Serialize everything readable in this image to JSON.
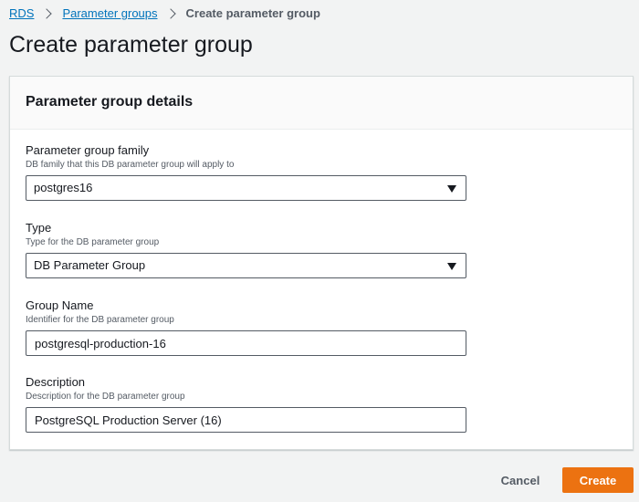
{
  "breadcrumb": {
    "items": [
      {
        "label": "RDS"
      },
      {
        "label": "Parameter groups"
      }
    ],
    "current": "Create parameter group"
  },
  "page": {
    "title": "Create parameter group"
  },
  "panel": {
    "title": "Parameter group details",
    "fields": {
      "family": {
        "label": "Parameter group family",
        "description": "DB family that this DB parameter group will apply to",
        "value": "postgres16"
      },
      "type": {
        "label": "Type",
        "description": "Type for the DB parameter group",
        "value": "DB Parameter Group"
      },
      "name": {
        "label": "Group Name",
        "description": "Identifier for the DB parameter group",
        "value": "postgresql-production-16"
      },
      "description": {
        "label": "Description",
        "description": "Description for the DB parameter group",
        "value": "PostgreSQL Production Server (16)"
      }
    }
  },
  "actions": {
    "cancel_label": "Cancel",
    "create_label": "Create"
  },
  "colors": {
    "link": "#0073bb",
    "primary_button": "#ec7211",
    "background": "#f2f3f3"
  }
}
